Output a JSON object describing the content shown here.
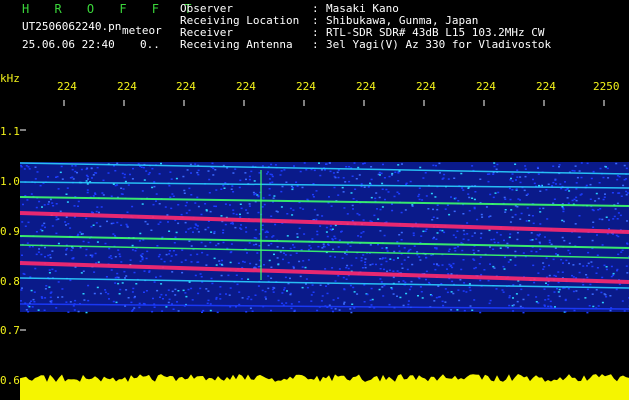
{
  "brand": "H R O F F T",
  "filename": "UT2506062240.pn",
  "type_label": "meteor",
  "timestamp": "25.06.06 22:40",
  "timestamp_extra": "0..",
  "info": [
    {
      "label": "Observer",
      "value": "Masaki Kano"
    },
    {
      "label": "Receiving Location",
      "value": "Shibukawa, Gunma, Japan"
    },
    {
      "label": "Receiver",
      "value": "RTL-SDR SDR# 43dB L15 103.2MHz CW"
    },
    {
      "label": "Receiving Antenna",
      "value": "3el Yagi(V) Az 330 for Vladivostok"
    }
  ],
  "axis": {
    "y_unit": "kHz",
    "y_ticks": [
      "1.1",
      "1.0",
      "0.9",
      "0.8",
      "0.7",
      "0.6"
    ],
    "x_ticks": [
      "224",
      "224",
      "224",
      "224",
      "224",
      "224",
      "224",
      "224",
      "224",
      "2250"
    ]
  },
  "colors": {
    "background": "#000000",
    "label_text": "#ffffff",
    "brand_green": "#3ad63a",
    "axis_yellow": "#f2f21a",
    "noise_blue": "#1c3cff",
    "signal_red": "#ff2a6e",
    "signal_green": "#3cff6a",
    "signal_cyan": "#2ad0ff",
    "level_bar": "#f5f500"
  }
}
